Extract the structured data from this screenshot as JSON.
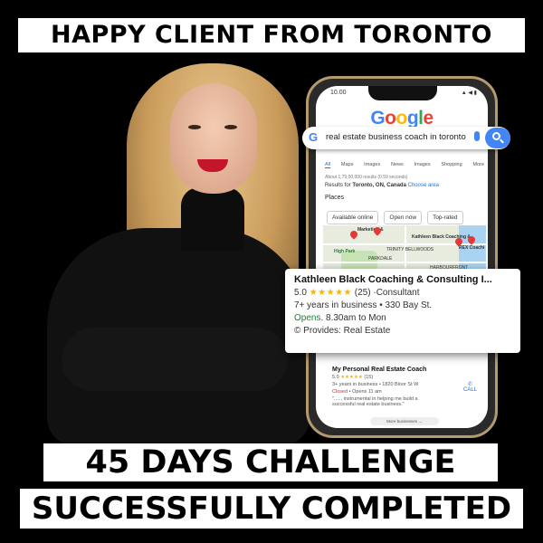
{
  "banners": {
    "top": "HAPPY CLIENT FROM TORONTO",
    "middle": "45 DAYS CHALLENGE",
    "bottom": "SUCCESSFULLY COMPLETED"
  },
  "phone": {
    "status_time": "10.00",
    "status_icons": "▲ ◀ ▮",
    "google_logo": [
      "G",
      "o",
      "o",
      "g",
      "l",
      "e"
    ],
    "logo_colors": [
      "#4285f4",
      "#ea4335",
      "#fbbc05",
      "#4285f4",
      "#34a853",
      "#ea4335"
    ],
    "tabs": [
      "All",
      "Maps",
      "Images",
      "News",
      "Images",
      "Shopping",
      "More"
    ],
    "result_count": "About 1,79,00,000 results (0.59 seconds)",
    "results_for_prefix": "Results for",
    "results_for_location": "Toronto, ON, Canada",
    "choose_area": "Choose area",
    "places_label": "Places",
    "chips": [
      "Available online",
      "Open now",
      "Top-rated"
    ],
    "map_labels": [
      "Kathleen Black Coaching &...",
      "REX Coachi",
      "High Park",
      "TRINITY BELLWOODS",
      "Marketing &",
      "PARKDALE",
      "HARBOURFRONT"
    ],
    "second_result": {
      "title": "My Personal Real Estate Coach",
      "rating": "5.0",
      "stars": "★★★★★",
      "count": "(15)",
      "details": "3+ years in business • 1820 Bloor St W",
      "closed": "Closed",
      "opens": " • Opens 11 am",
      "quote_line1": "\"...... instrumental in helping me build a",
      "quote_line2": "successful real estate business.\""
    },
    "call_label": "CALL",
    "more_button": "More businesses →"
  },
  "search": {
    "g_letter": "G",
    "query": "real estate business coach in toronto"
  },
  "card": {
    "title": "Kathleen Black Coaching & Consulting I...",
    "rating": "5.0",
    "stars": "★★★★★",
    "count": "(25)",
    "category": "·Consultant",
    "details": "7+ years in business • 330 Bay St.",
    "opens_label": "Opens",
    "opens_time": ". 8.30am to Mon",
    "provides": "© Provides: Real Estate"
  }
}
